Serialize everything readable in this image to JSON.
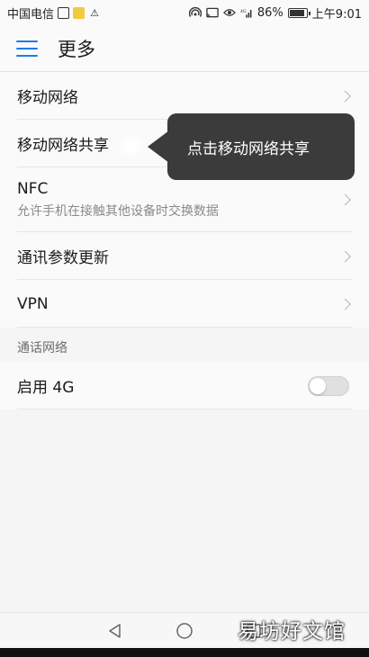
{
  "status_bar": {
    "carrier": "中国电信",
    "network_type": "4G",
    "battery": "86%",
    "time": "上午9:01"
  },
  "app_bar": {
    "title": "更多"
  },
  "items": [
    {
      "label": "移动网络"
    },
    {
      "label": "移动网络共享"
    },
    {
      "label": "NFC",
      "sub": "允许手机在接触其他设备时交换数据"
    },
    {
      "label": "通讯参数更新"
    },
    {
      "label": "VPN"
    }
  ],
  "section": {
    "title": "通话网络",
    "toggle_item": {
      "label": "启用 4G",
      "enabled": false
    }
  },
  "tooltip": {
    "text": "点击移动网络共享"
  },
  "watermark": "易坊好文馆",
  "colors": {
    "accent": "#1e7ce8",
    "tooltip_bg": "#3b3b3b",
    "background": "#f5f5f5"
  }
}
